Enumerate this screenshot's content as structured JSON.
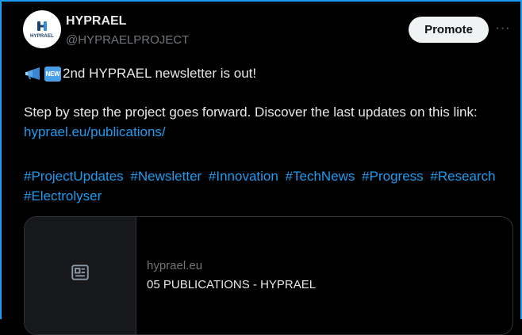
{
  "post": {
    "author_name": "HYPRAEL",
    "author_handle": "@HYPRAELPROJECT",
    "avatar_text": "HYPRAEL",
    "promote_label": "Promote",
    "more_label": "···",
    "new_badge": "NEW",
    "headline": "2nd HYPRAEL newsletter is out!",
    "body_text": "Step by step the project goes forward. Discover the last updates on this link: ",
    "body_link": "hyprael.eu/publications/",
    "hashtags": [
      "#ProjectUpdates",
      "#Newsletter",
      "#Innovation",
      "#TechNews",
      "#Progress",
      "#Research",
      "#Electrolyser"
    ]
  },
  "link_card": {
    "domain": "hyprael.eu",
    "title": "05 PUBLICATIONS - HYPRAEL"
  },
  "icons": [
    "hyprael-logo-icon",
    "megaphone-icon",
    "new-badge-icon",
    "more-icon",
    "article-icon"
  ],
  "colors": {
    "accent": "#1d9bf0",
    "background": "#000000",
    "text": "#e7e9ea",
    "muted": "#71767b"
  }
}
